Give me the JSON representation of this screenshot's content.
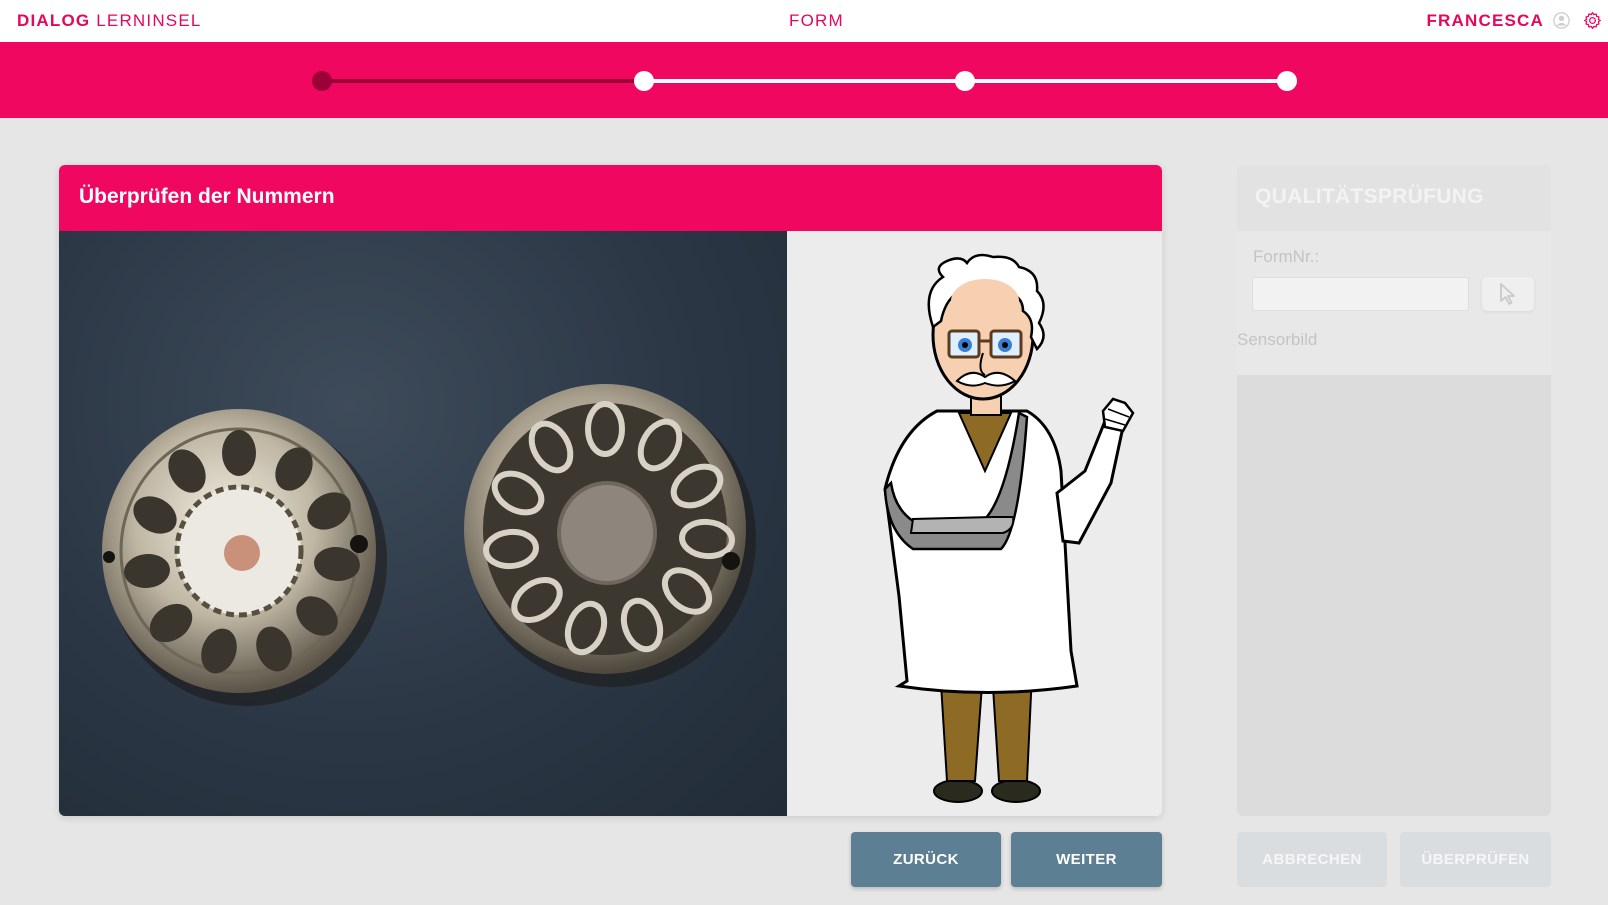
{
  "header": {
    "brand_bold": "DIALOG",
    "brand_light": "LERNINSEL",
    "center_title": "FORM",
    "user_name": "FRANCESCA",
    "user_icon": "user-circle-icon",
    "settings_icon": "gear-icon"
  },
  "progress": {
    "total_steps": 4,
    "current_step": 1
  },
  "main_card": {
    "title": "Überprüfen der Nummern"
  },
  "buttons": {
    "back": "ZURÜCK",
    "next": "WEITER",
    "cancel": "ABBRECHEN",
    "check": "ÜBERPRÜFEN"
  },
  "quality_panel": {
    "title": "QUALITÄTSPRÜFUNG",
    "form_nr_label": "FormNr.:",
    "form_nr_value": "",
    "select_icon": "cursor-pointer-icon",
    "sensor_image_alt": "Sensorbild"
  },
  "colors": {
    "accent": "#f0075f",
    "accent_dark": "#9b0038",
    "button_primary": "#5d7f93",
    "button_disabled": "#dadde0"
  }
}
